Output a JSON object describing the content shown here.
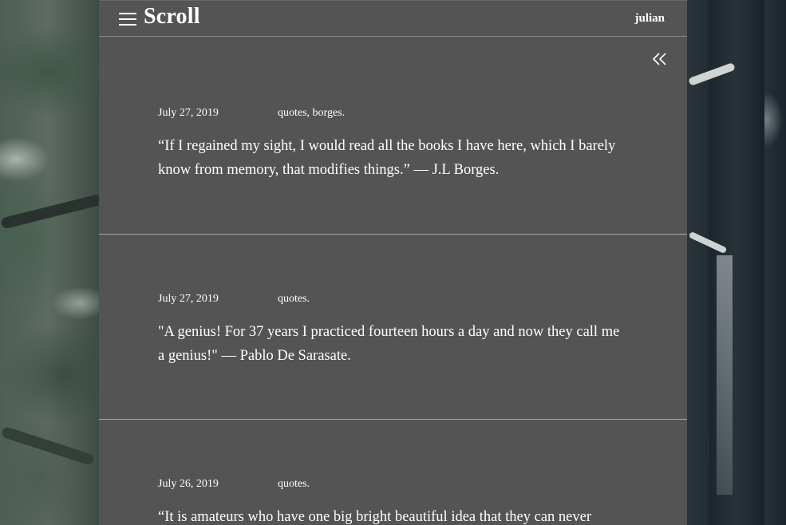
{
  "header": {
    "brand": "Scroll",
    "user": "julian"
  },
  "icons": {
    "menu": "hamburger-menu-icon",
    "collapse": "double-chevron-left-icon"
  },
  "posts": [
    {
      "date": "July 27, 2019",
      "tags": "quotes, borges.",
      "text": "“If I regained my sight, I would read all the books I have here, which I barely know from memory, that modifies things.” — J.L Borges."
    },
    {
      "date": "July 27, 2019",
      "tags": "quotes.",
      "text": "\"A genius! For 37 years I practiced fourteen hours a day and now they call me a genius!\" — Pablo De Sarasate."
    },
    {
      "date": "July 26, 2019",
      "tags": "quotes.",
      "text": "“It is amateurs who have one big bright beautiful idea that they can never"
    }
  ],
  "colors": {
    "panel": "#545454",
    "text": "#ffffff",
    "divider": "#a9a9a9"
  }
}
